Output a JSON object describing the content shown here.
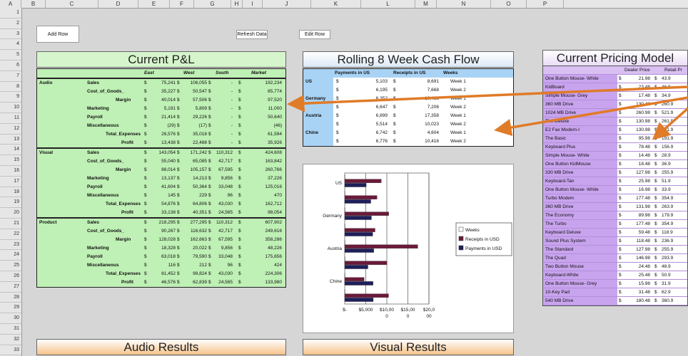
{
  "columns": [
    "A",
    "B",
    "C",
    "D",
    "E",
    "F",
    "G",
    "H",
    "I",
    "J",
    "K",
    "L",
    "M",
    "N",
    "O",
    "P"
  ],
  "rows": [
    "1",
    "2",
    "3",
    "4",
    "5",
    "6",
    "7",
    "8",
    "9",
    "10",
    "11",
    "12",
    "13",
    "14",
    "15",
    "16",
    "17",
    "18",
    "19",
    "20",
    "21",
    "22",
    "23",
    "24",
    "25",
    "26",
    "27",
    "28",
    "29",
    "30",
    "31",
    "32",
    "33"
  ],
  "buttons": {
    "add_row": "Add Row",
    "refresh_data": "Refresh Data",
    "edit_row": "Edit Row"
  },
  "pl": {
    "title": "Current P&L",
    "headers": [
      "East",
      "West",
      "South",
      "Market"
    ],
    "groups": [
      {
        "name": "Audio",
        "rows": [
          {
            "label": "Sales",
            "e": "75,241",
            "w": "106,055",
            "s": "-",
            "m": "192,234"
          },
          {
            "label": "Cost_of_Goods_",
            "e": "35,227",
            "w": "50,547",
            "s": "-",
            "m": "85,774"
          },
          {
            "label": "Margin",
            "e": "40,014",
            "w": "57,506",
            "s": "-",
            "m": "97,520"
          },
          {
            "label": "Marketing",
            "e": "5,191",
            "w": "5,809",
            "s": "-",
            "m": "11,000"
          },
          {
            "label": "Payroll",
            "e": "21,414",
            "w": "29,226",
            "s": "-",
            "m": "50,640"
          },
          {
            "label": "Miscellaneous",
            "e": "(29)",
            "w": "(17)",
            "s": "-",
            "m": "(46)"
          },
          {
            "label": "Total_Expenses",
            "e": "26,576",
            "w": "35,018",
            "s": "-",
            "m": "61,594"
          },
          {
            "label": "Profit",
            "e": "13,438",
            "w": "22,488",
            "s": "-",
            "m": "35,926"
          }
        ]
      },
      {
        "name": "Visual",
        "rows": [
          {
            "label": "Sales",
            "e": "143,054",
            "w": "171,242",
            "s": "110,312",
            "m": "424,608"
          },
          {
            "label": "Cost_of_Goods_",
            "e": "55,040",
            "w": "65,085",
            "s": "42,717",
            "m": "163,842"
          },
          {
            "label": "Margin",
            "e": "88,014",
            "w": "105,157",
            "s": "67,595",
            "m": "260,766"
          },
          {
            "label": "Marketing",
            "e": "13,137",
            "w": "14,213",
            "s": "9,856",
            "m": "37,226"
          },
          {
            "label": "Payroll",
            "e": "41,604",
            "w": "50,364",
            "s": "33,048",
            "m": "125,016"
          },
          {
            "label": "Miscellaneous",
            "e": "145",
            "w": "229",
            "s": "96",
            "m": "470"
          },
          {
            "label": "Total_Expenses",
            "e": "54,876",
            "w": "64,806",
            "s": "43,030",
            "m": "162,712"
          },
          {
            "label": "Profit",
            "e": "33,138",
            "w": "40,351",
            "s": "24,565",
            "m": "98,054"
          }
        ]
      },
      {
        "name": "Product",
        "rows": [
          {
            "label": "Sales",
            "e": "218,295",
            "w": "277,295",
            "s": "110,312",
            "m": "607,902"
          },
          {
            "label": "Cost_of_Goods_",
            "e": "90,267",
            "w": "116,632",
            "s": "42,717",
            "m": "249,616"
          },
          {
            "label": "Margin",
            "e": "128,028",
            "w": "162,663",
            "s": "67,595",
            "m": "358,286"
          },
          {
            "label": "Marketing",
            "e": "18,328",
            "w": "20,022",
            "s": "9,856",
            "m": "48,226"
          },
          {
            "label": "Payroll",
            "e": "63,018",
            "w": "79,590",
            "s": "33,048",
            "m": "175,656"
          },
          {
            "label": "Miscellaneous",
            "e": "116",
            "w": "212",
            "s": "96",
            "m": "424"
          },
          {
            "label": "Total_Expenses",
            "e": "81,452",
            "w": "99,824",
            "s": "43,030",
            "m": "224,306"
          },
          {
            "label": "Profit",
            "e": "46,576",
            "w": "62,839",
            "s": "24,565",
            "m": "133,980"
          }
        ]
      }
    ]
  },
  "cashflow": {
    "title": "Rolling 8 Week Cash Flow",
    "headers": [
      "Payments in US",
      "Receipts in US",
      "Weeks"
    ],
    "rows": [
      {
        "country": "US",
        "pay": "5,103",
        "rec": "8,691",
        "week": "Week 1"
      },
      {
        "country": "",
        "pay": "6,195",
        "rec": "7,668",
        "week": "Week 2"
      },
      {
        "country": "Germany",
        "pay": "6,352",
        "rec": "10,458",
        "week": "Week 1"
      },
      {
        "country": "",
        "pay": "6,647",
        "rec": "7,206",
        "week": "Week 2"
      },
      {
        "country": "Austria",
        "pay": "6,899",
        "rec": "17,358",
        "week": "Week 1"
      },
      {
        "country": "",
        "pay": "5,514",
        "rec": "10,023",
        "week": "Week 2"
      },
      {
        "country": "Chine",
        "pay": "6,742",
        "rec": "4,604",
        "week": "Week 1"
      },
      {
        "country": "",
        "pay": "6,776",
        "rec": "10,416",
        "week": "Week 2"
      }
    ]
  },
  "chart_data": {
    "type": "bar",
    "orientation": "horizontal",
    "categories": [
      "US",
      "",
      "Germany",
      "",
      "Austria",
      "",
      "Chine",
      ""
    ],
    "series": [
      {
        "name": "Weeks",
        "values": [
          1,
          2,
          1,
          2,
          1,
          2,
          1,
          2
        ],
        "color": "#ffffff"
      },
      {
        "name": "Receipts in USD",
        "values": [
          8691,
          7668,
          10458,
          7206,
          17358,
          10023,
          4604,
          10416
        ],
        "color": "#6b1a3a"
      },
      {
        "name": "Payments in USD",
        "values": [
          5103,
          6195,
          6352,
          6647,
          6899,
          5514,
          6742,
          6776
        ],
        "color": "#1e1e5a"
      }
    ],
    "xticks": [
      "$-",
      "$5,000",
      "$10,00\n0",
      "$15,00\n0",
      "$20,0\n00"
    ],
    "xlim": [
      0,
      20000
    ],
    "grid": true,
    "legend": "right"
  },
  "pricing": {
    "title": "Current Pricing Model",
    "headers": [
      "Dealer Price",
      "Retail Pr"
    ],
    "rows": [
      {
        "name": "One Button Mouse- White",
        "d": "21.98",
        "r": "43.9"
      },
      {
        "name": "KidBoard",
        "d": "23.48",
        "r": "46.9"
      },
      {
        "name": "Simple Mouse- Grey",
        "d": "17.48",
        "r": "34.9"
      },
      {
        "name": "360 MB Drive",
        "d": "130.48",
        "r": "260.9"
      },
      {
        "name": "1024 MB Drive",
        "d": "260.98",
        "r": "521.9"
      },
      {
        "name": "The Deluxe",
        "d": "130.98",
        "r": "261.9"
      },
      {
        "name": "E2 Fax Modem-I",
        "d": "130.98",
        "r": "261.9"
      },
      {
        "name": "The Basic",
        "d": "95.98",
        "r": "191.9"
      },
      {
        "name": "Keyboard Plus",
        "d": "78.48",
        "r": "156.9"
      },
      {
        "name": "Simple Mouse- White",
        "d": "14.48",
        "r": "28.9"
      },
      {
        "name": "One Button KidMouse",
        "d": "18.48",
        "r": "36.9"
      },
      {
        "name": "330 MB Drive",
        "d": "127.98",
        "r": "255.9"
      },
      {
        "name": "Keyboard-Tan",
        "d": "25.98",
        "r": "51.9"
      },
      {
        "name": "One Button Mouse- White",
        "d": "16.98",
        "r": "33.9"
      },
      {
        "name": "Turbo Modem",
        "d": "177.48",
        "r": "354.9"
      },
      {
        "name": "360 MB Drive",
        "d": "131.98",
        "r": "263.9"
      },
      {
        "name": "The Economy",
        "d": "89.98",
        "r": "179.9"
      },
      {
        "name": "The Turbo",
        "d": "177.48",
        "r": "354.9"
      },
      {
        "name": "Keyboard Deluxe",
        "d": "59.48",
        "r": "118.9"
      },
      {
        "name": "Sound Plus System",
        "d": "118.48",
        "r": "236.9"
      },
      {
        "name": "The Standard",
        "d": "127.98",
        "r": "255.9"
      },
      {
        "name": "The Quad",
        "d": "146.98",
        "r": "293.9"
      },
      {
        "name": "Two Button Mouse",
        "d": "24.48",
        "r": "48.9"
      },
      {
        "name": "Keyboard-White",
        "d": "25.48",
        "r": "50.9"
      },
      {
        "name": "One Button Mouse- Grey",
        "d": "15.98",
        "r": "31.9"
      },
      {
        "name": "10-Key Pad",
        "d": "31.48",
        "r": "62.9"
      },
      {
        "name": "540 MB Drive",
        "d": "180.48",
        "r": "360.9"
      }
    ]
  },
  "results": {
    "audio_title": "Audio Results",
    "visual_title": "Visual Results"
  },
  "currency": "$",
  "accent": {
    "arrow": "#e07b28",
    "pl": "#bff0b5",
    "cashflow": "#a9d3f5",
    "pricing": "#c9a4ee"
  }
}
